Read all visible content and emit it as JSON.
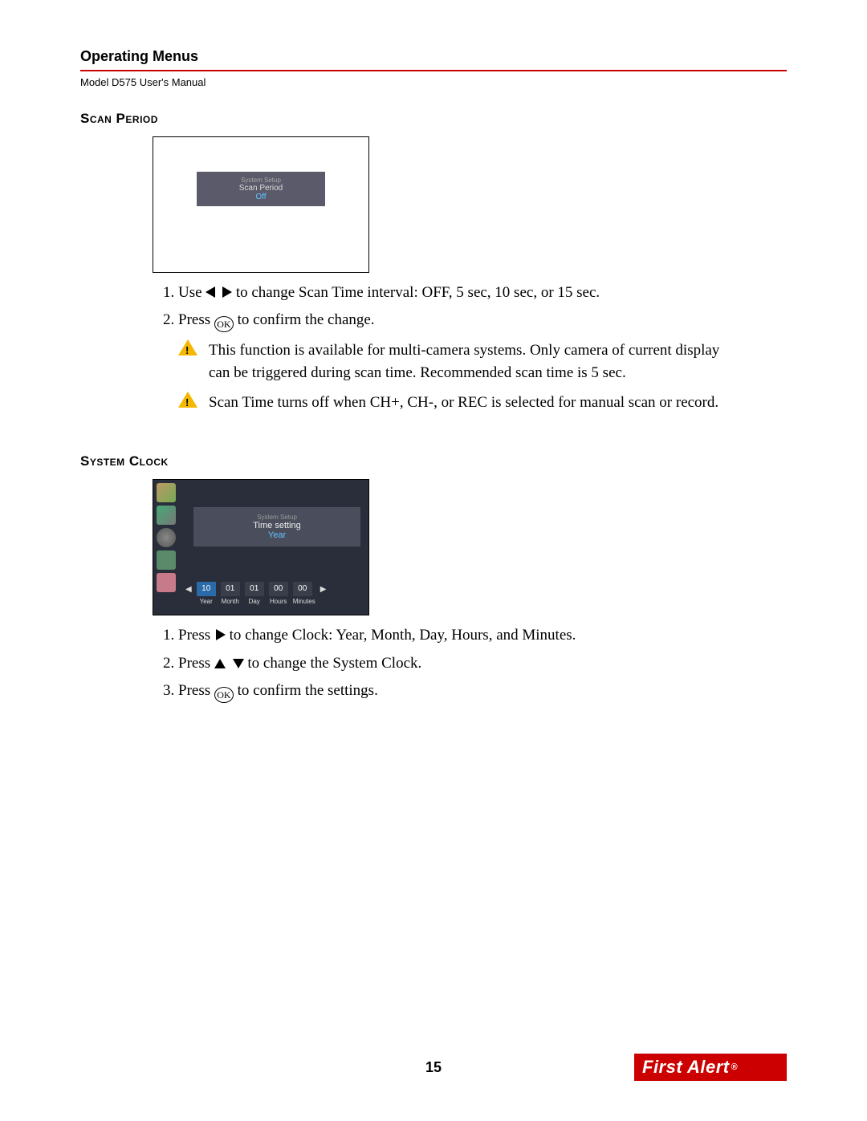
{
  "header": {
    "title": "Operating Menus",
    "sub": "Model D575 User's Manual"
  },
  "scan": {
    "title": "Scan Period",
    "fig": {
      "l1": "System Setup",
      "l2": "Scan Period",
      "l3": "Off"
    },
    "step1_a": "Use ",
    "step1_b": " to change Scan Time interval: OFF, 5 sec, 10 sec, or 15 sec.",
    "step2_a": "Press ",
    "step2_b": " to confirm the change.",
    "note1": "This function is available for multi-camera systems. Only camera of current display can be triggered during scan time. Recommended scan time is 5 sec.",
    "note2": "Scan Time turns off when CH+, CH-, or REC is selected for manual scan or record."
  },
  "clock": {
    "title": "System Clock",
    "fig_center": {
      "t1": "System Setup",
      "t2": "Time setting",
      "t3": "Year"
    },
    "fig_fields": [
      {
        "label": "Year",
        "value": "10"
      },
      {
        "label": "Month",
        "value": "01"
      },
      {
        "label": "Day",
        "value": "01"
      },
      {
        "label": "Hours",
        "value": "00"
      },
      {
        "label": "Minutes",
        "value": "00"
      }
    ],
    "step1_a": "Press ",
    "step1_b": " to change Clock: Year, Month, Day, Hours, and Minutes.",
    "step2_a": "Press ",
    "step2_b": " to change the System Clock.",
    "step3_a": "Press ",
    "step3_b": " to confirm the settings."
  },
  "footer": {
    "page": "15",
    "logo": "First Alert",
    "reg": "®"
  },
  "ok_label": "OK"
}
